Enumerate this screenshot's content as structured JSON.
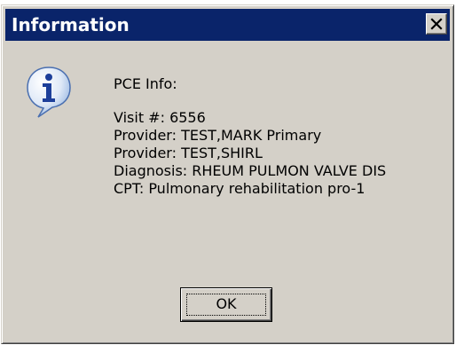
{
  "window": {
    "title": "Information",
    "close_icon": "close-icon"
  },
  "message": {
    "icon": "info-icon",
    "heading": "PCE Info:",
    "lines": [
      "Visit #: 6556",
      "Provider: TEST,MARK Primary",
      "Provider: TEST,SHIRL",
      "Diagnosis: RHEUM PULMON VALVE DIS",
      "CPT: Pulmonary rehabilitation pro-1"
    ]
  },
  "buttons": {
    "ok_label": "OK"
  },
  "colors": {
    "titlebar": "#0a246a",
    "face": "#d4d0c8"
  }
}
